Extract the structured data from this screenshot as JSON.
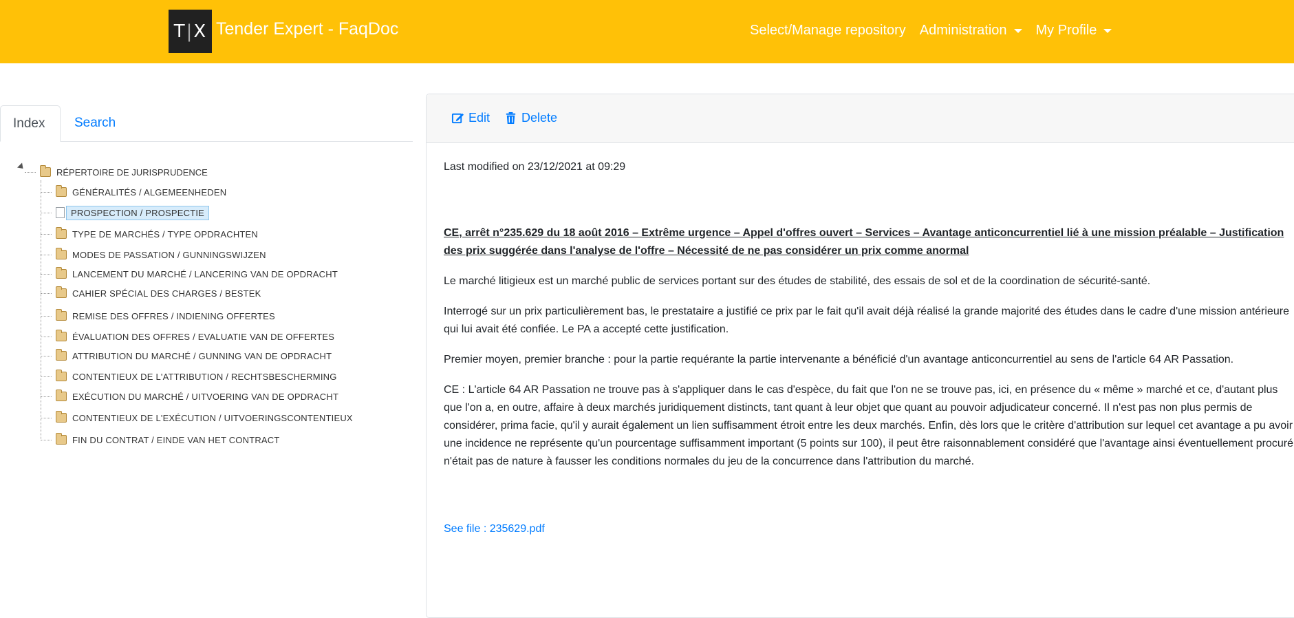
{
  "header": {
    "logo_text_left": "T",
    "logo_text_right": "X",
    "brand": "Tender Expert - FaqDoc",
    "nav": [
      {
        "label": "Select/Manage repository"
      },
      {
        "label": "Administration"
      },
      {
        "label": "My Profile"
      }
    ]
  },
  "tabs": [
    {
      "label": "Index"
    },
    {
      "label": "Search"
    }
  ],
  "tree": {
    "root": "RÉPERTOIRE DE JURISPRUDENCE",
    "items": [
      {
        "label": "GÉNÉRALITÉS / ALGEMEENHEDEN",
        "icon": "folder-icon"
      },
      {
        "label": "PROSPECTION / PROSPECTIE",
        "icon": "file-icon",
        "selected": true
      },
      {
        "label": "TYPE DE MARCHÉS / TYPE OPDRACHTEN",
        "icon": "folder-icon"
      },
      {
        "label": "MODES DE PASSATION / GUNNINGSWIJZEN",
        "icon": "folder-icon"
      },
      {
        "label": "LANCEMENT DU MARCHÉ / LANCERING VAN DE OPDRACHT",
        "icon": "folder-icon"
      },
      {
        "label": "CAHIER SPÉCIAL DES CHARGES / BESTEK",
        "icon": "folder-icon"
      },
      {
        "label": "REMISE DES OFFRES / INDIENING OFFERTES",
        "icon": "folder-icon"
      },
      {
        "label": "ÉVALUATION DES OFFRES / EVALUATIE VAN DE OFFERTES",
        "icon": "folder-icon"
      },
      {
        "label": "ATTRIBUTION DU MARCHÉ / GUNNING VAN DE OPDRACHT",
        "icon": "folder-icon"
      },
      {
        "label": "CONTENTIEUX DE L'ATTRIBUTION / RECHTSBESCHERMING",
        "icon": "folder-icon"
      },
      {
        "label": "EXÉCUTION DU MARCHÉ / UITVOERING VAN DE OPDRACHT",
        "icon": "folder-icon"
      },
      {
        "label": "CONTENTIEUX DE L'EXÉCUTION / UITVOERINGSCONTENTIEUX",
        "icon": "folder-icon"
      },
      {
        "label": "FIN DU CONTRAT / EINDE VAN HET CONTRACT",
        "icon": "folder-icon"
      }
    ]
  },
  "panel": {
    "edit_label": "Edit",
    "delete_label": "Delete",
    "modified": "Last modified on 23/12/2021 at 09:29",
    "title": "CE, arrêt n°235.629 du 18 août 2016 – Extrême urgence – Appel d'offres ouvert – Services – Avantage anticoncurrentiel lié à une mission préalable – Justification des prix suggérée dans l'analyse de l'offre – Nécessité de ne pas considérer un prix comme anormal",
    "paragraphs": [
      "Le marché litigieux est un marché public de services portant sur des études de stabilité, des essais de sol et de la coordination de sécurité-santé.",
      "Interrogé sur un prix particulièrement bas, le prestataire a justifié ce prix par le fait qu'il avait déjà réalisé la grande majorité des études dans le cadre d'une mission antérieure qui lui avait été confiée. Le PA a accepté cette justification.",
      "Premier moyen, premier branche : pour la partie requérante la partie intervenante a bénéficié d'un avantage anticoncurrentiel au sens de l'article 64 AR Passation.",
      "CE : L'article 64 AR Passation ne trouve pas à s'appliquer dans le cas d'espèce, du fait que l'on ne se trouve pas, ici, en présence du « même » marché et ce, d'autant plus que l'on a, en outre, affaire à deux marchés juridiquement distincts, tant quant à leur objet que quant au pouvoir adjudicateur concerné. Il n'est pas non plus permis de considérer, prima facie, qu'il y aurait également un lien suffisamment étroit entre les deux marchés. Enfin, dès lors que le critère d'attribution sur lequel cet avantage a pu avoir une incidence ne représente qu'un pourcentage suffisamment important (5 points sur 100), il peut être raisonnablement considéré que l'avantage ainsi éventuellement procuré n'était pas de nature à fausser les conditions normales du jeu de la concurrence dans l'attribution du marché."
    ],
    "file_link": "See file : 235629.pdf"
  },
  "colors": {
    "navbar": "#ffc107",
    "link": "#007bff"
  }
}
